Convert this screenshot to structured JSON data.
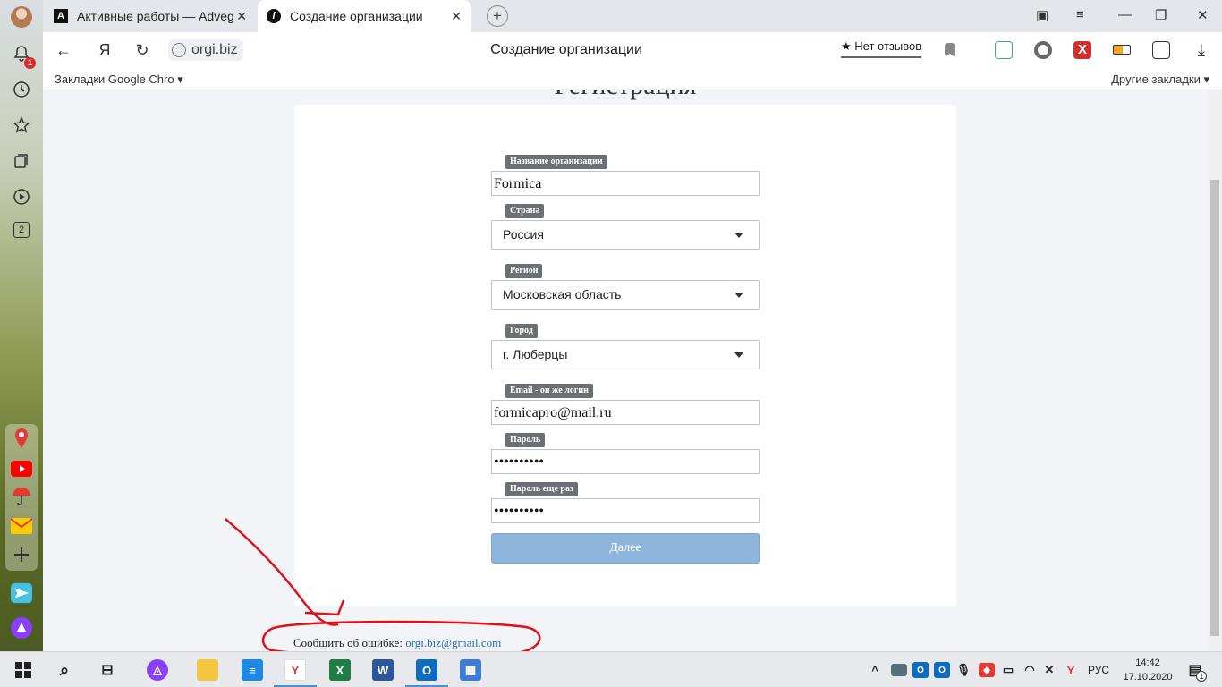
{
  "browser": {
    "tabs": [
      {
        "label": "Активные работы — Advego",
        "favicon": "A"
      },
      {
        "label": "Создание организации",
        "favicon": "i"
      }
    ],
    "new_tab_symbol": "+",
    "address": {
      "url": "orgi.biz",
      "page_title": "Создание организации",
      "yandex_symbol": "Я"
    },
    "reviews": "★ Нет отзывов",
    "bookmarks": {
      "left": "Закладки Google Chro ▾",
      "right": "Другие закладки ▾"
    },
    "sidebar_badge": "1",
    "sidebar_counter": "2"
  },
  "page": {
    "heading": "Регистрация",
    "form": {
      "org_name": {
        "label": "Название организации",
        "value": "Formica"
      },
      "country": {
        "label": "Страна",
        "value": "Россия"
      },
      "region": {
        "label": "Регион",
        "value": "Московская область"
      },
      "city": {
        "label": "Город",
        "value": "г. Люберцы"
      },
      "email": {
        "label": "Email - он же логин",
        "value": "formicapro@mail.ru"
      },
      "password": {
        "label": "Пароль",
        "value": "••••••••••"
      },
      "password_repeat": {
        "label": "Пароль еще раз",
        "value": "••••••••••"
      },
      "submit_label": "Далее"
    },
    "footer": {
      "text": "Сообщить об ошибке: ",
      "email": "orgi.biz@gmail.com"
    }
  },
  "taskbar": {
    "lang": "РУС",
    "time": "14:42",
    "date": "17.10.2020",
    "notification_count": "1"
  },
  "colors": {
    "submit": "#8eb5dc",
    "annotation": "#e0101a",
    "link": "#2a6db3"
  }
}
